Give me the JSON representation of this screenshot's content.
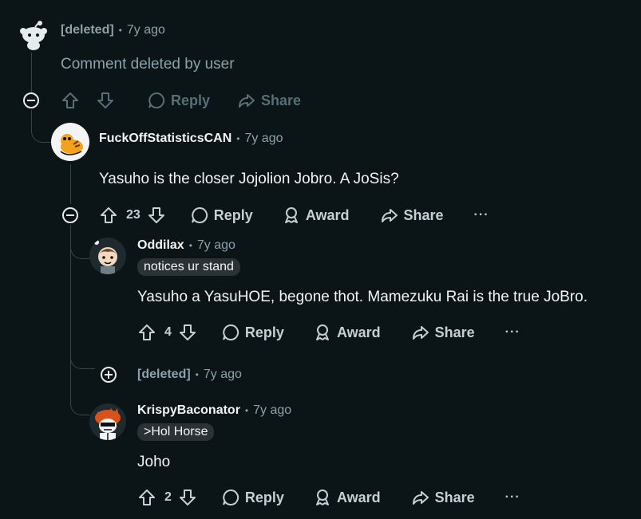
{
  "colors": {
    "background": "#0b1416",
    "text": "#f2f4f5",
    "muted": "#8ba2ad",
    "line": "#3a4446"
  },
  "comments": [
    {
      "id": "c1",
      "author": "[deleted]",
      "separator": "•",
      "time": "7y ago",
      "body": "Comment deleted by user",
      "actions": {
        "reply": "Reply",
        "share": "Share"
      }
    },
    {
      "id": "c2",
      "author": "FuckOffStatisticsCAN",
      "separator": "•",
      "time": "7y ago",
      "body": "Yasuho is the closer Jojolion Jobro. A JoSis?",
      "score": "23",
      "actions": {
        "reply": "Reply",
        "award": "Award",
        "share": "Share",
        "more": "···"
      }
    },
    {
      "id": "c3",
      "author": "Oddilax",
      "separator": "•",
      "time": "7y ago",
      "flair": "notices ur stand",
      "body": "Yasuho a YasuHOE, begone thot. Mamezuku Rai is the true JoBro.",
      "score": "4",
      "actions": {
        "reply": "Reply",
        "award": "Award",
        "share": "Share",
        "more": "···"
      }
    },
    {
      "id": "c4",
      "author": "[deleted]",
      "separator": "•",
      "time": "7y ago",
      "collapsed": true
    },
    {
      "id": "c5",
      "author": "KrispyBaconator",
      "separator": "•",
      "time": "7y ago",
      "flair": ">Hol Horse",
      "body": "Joho",
      "score": "2",
      "actions": {
        "reply": "Reply",
        "award": "Award",
        "share": "Share",
        "more": "···"
      }
    }
  ],
  "icons": [
    "snoo-avatar-icon",
    "upvote-icon",
    "downvote-icon",
    "reply-icon",
    "award-icon",
    "share-icon",
    "collapse-icon",
    "expand-icon",
    "more-icon"
  ]
}
